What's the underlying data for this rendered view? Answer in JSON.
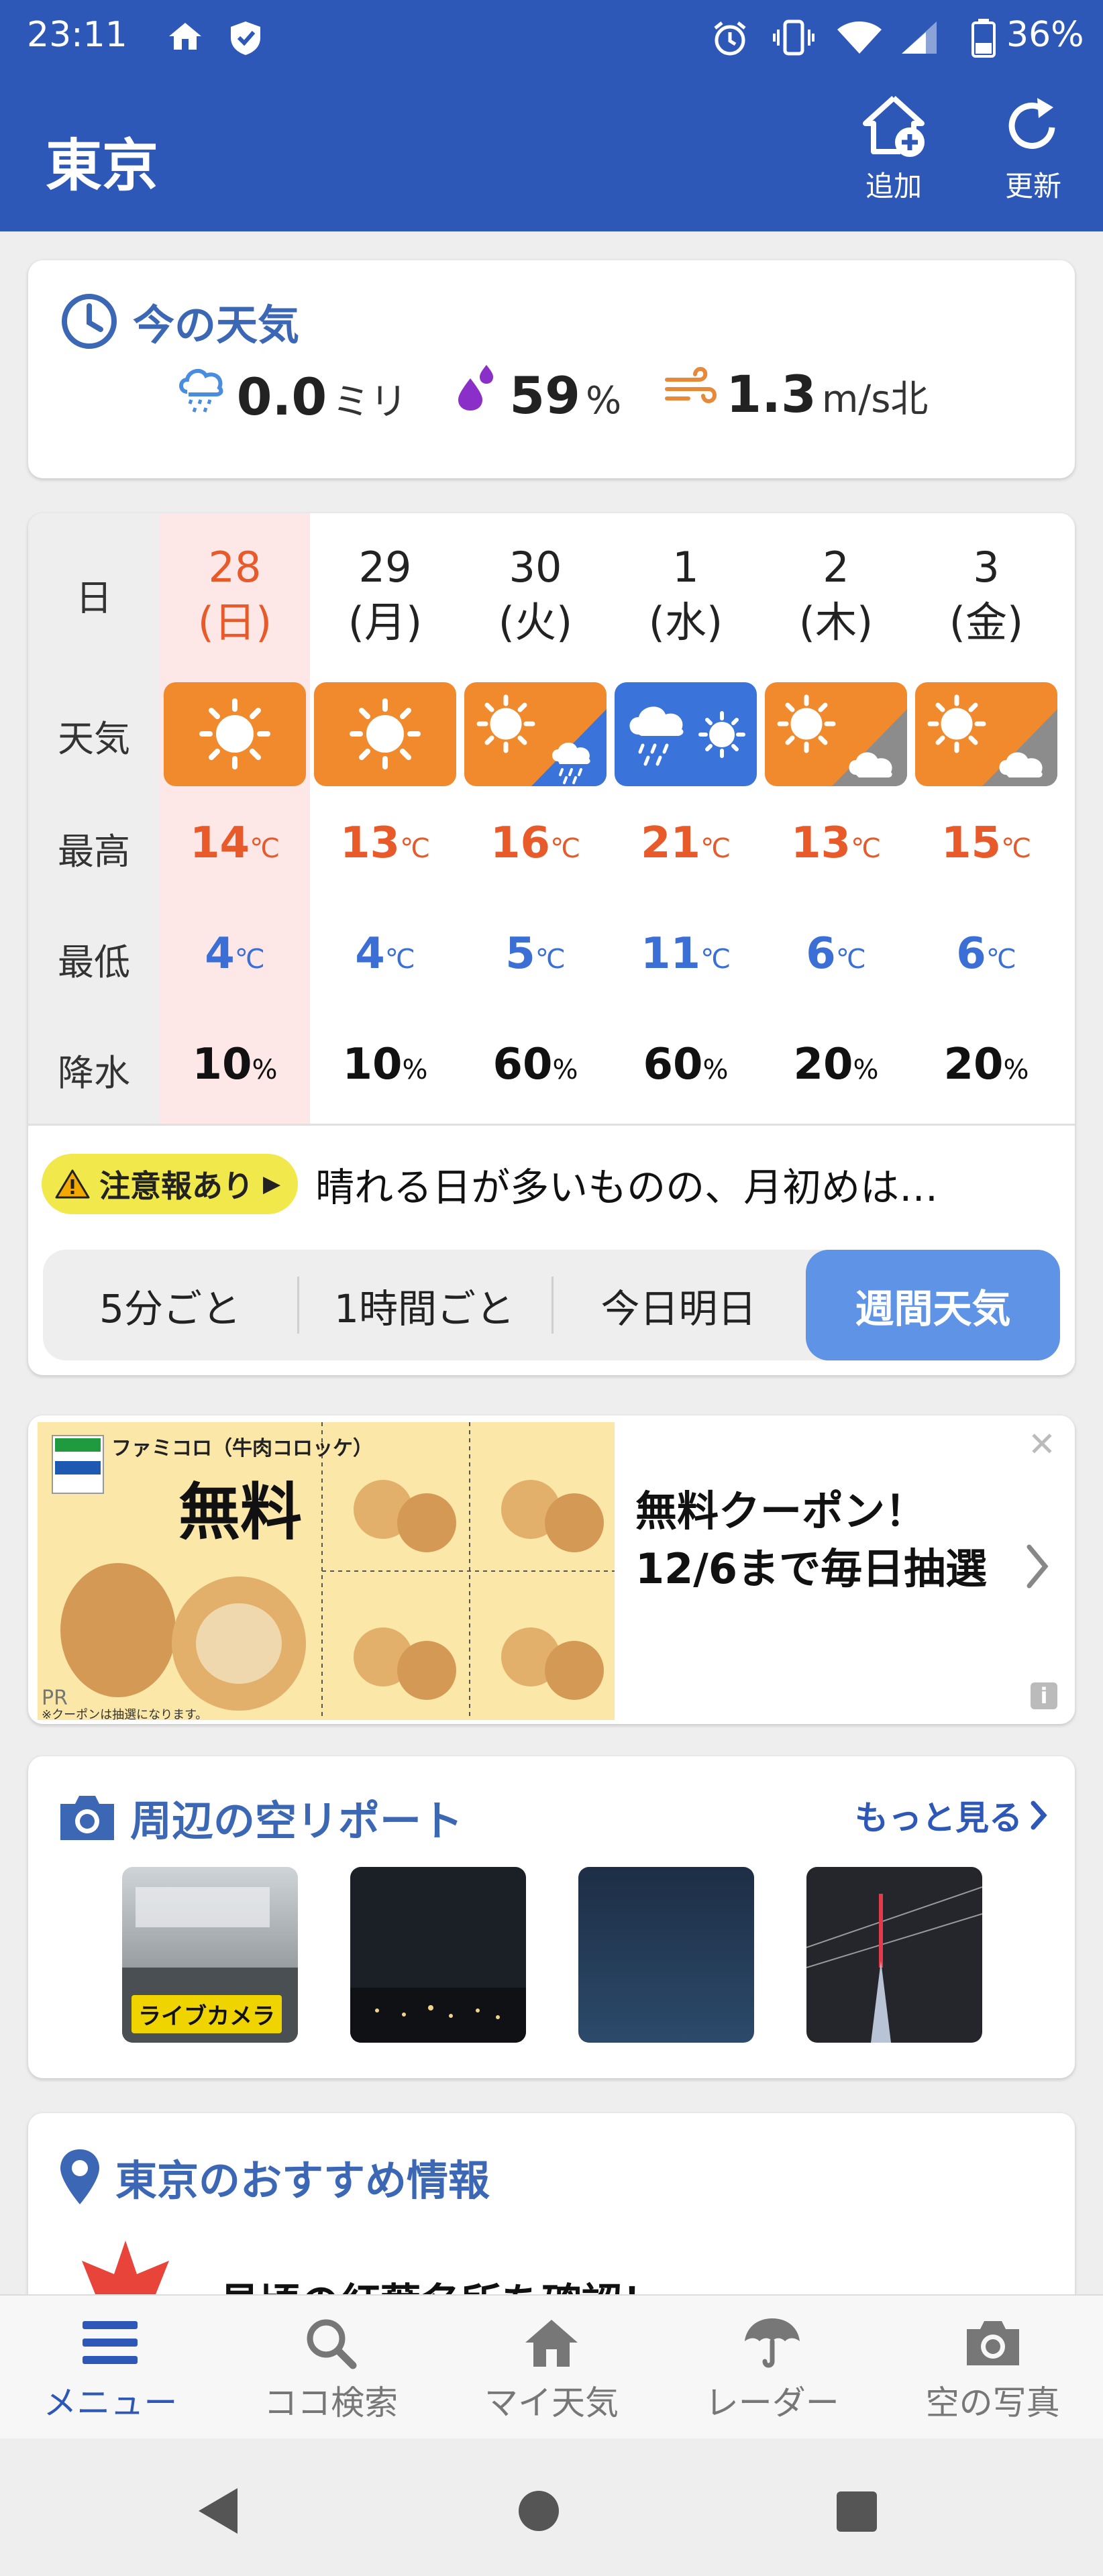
{
  "status_bar": {
    "time": "23:11",
    "battery": "36%"
  },
  "header": {
    "title": "東京",
    "add_label": "追加",
    "refresh_label": "更新"
  },
  "current": {
    "title": "今の天気",
    "precip_value": "0.0",
    "precip_unit": "ミリ",
    "humidity_value": "59",
    "humidity_unit": "%",
    "wind_value": "1.3",
    "wind_unit": "m/s北"
  },
  "forecast": {
    "row_labels": {
      "day": "日",
      "weather": "天気",
      "high": "最高",
      "low": "最低",
      "rain": "降水"
    },
    "temp_unit": "℃",
    "rain_unit": "%",
    "days": [
      {
        "date": "28",
        "dow": "(日)",
        "icon": "sunny-icon",
        "high": "14",
        "low": "4",
        "rain": "10"
      },
      {
        "date": "29",
        "dow": "(月)",
        "icon": "sunny-icon",
        "high": "13",
        "low": "4",
        "rain": "10"
      },
      {
        "date": "30",
        "dow": "(火)",
        "icon": "sunny-then-rain-icon",
        "high": "16",
        "low": "5",
        "rain": "60"
      },
      {
        "date": "1",
        "dow": "(水)",
        "icon": "rain-then-sunny-icon",
        "high": "21",
        "low": "11",
        "rain": "60"
      },
      {
        "date": "2",
        "dow": "(木)",
        "icon": "sunny-then-cloudy-icon",
        "high": "13",
        "low": "6",
        "rain": "20"
      },
      {
        "date": "3",
        "dow": "(金)",
        "icon": "sunny-then-cloudy-icon",
        "high": "15",
        "low": "6",
        "rain": "20"
      }
    ],
    "notice_badge": "注意報あり",
    "notice_text": "晴れる日が多いものの、月初めは…",
    "tabs": [
      "5分ごと",
      "1時間ごと",
      "今日明日",
      "週間天気"
    ],
    "active_tab": "週間天気"
  },
  "ad": {
    "image_title": "ファミコロ（牛肉コロッケ）",
    "image_free": "無料",
    "line1": "無料クーポン！",
    "line2": "12/6まで毎日抽選",
    "pr": "PR",
    "note": "※クーポンは抽選になります。",
    "info": "i"
  },
  "sky_report": {
    "title": "周辺の空リポート",
    "more": "もっと見る",
    "live_badge": "ライブカメラ"
  },
  "recommend": {
    "title": "東京のおすすめ情報",
    "item_text": "見頃の紅葉名所を確認！"
  },
  "bottom_nav": {
    "menu": "メニュー",
    "search": "ココ検索",
    "my_weather": "マイ天気",
    "radar": "レーダー",
    "sky_photo": "空の写真"
  },
  "colors": {
    "brand_blue": "#2e58b8",
    "high_temp": "#e85a2a",
    "low_temp": "#3c6fd6",
    "sunny_orange": "#f08a2c",
    "rain_blue": "#3a74db"
  }
}
